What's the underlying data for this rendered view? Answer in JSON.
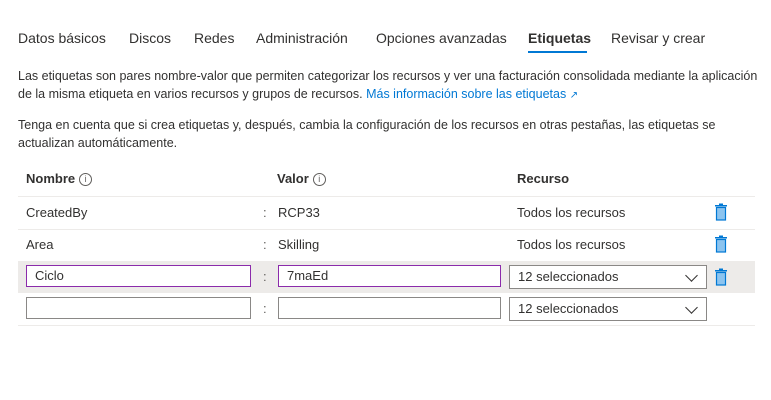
{
  "tabs": [
    {
      "label": "Datos básicos"
    },
    {
      "label": "Discos"
    },
    {
      "label": "Redes"
    },
    {
      "label": "Administración"
    },
    {
      "label": "Opciones avanzadas"
    },
    {
      "label": "Etiquetas",
      "active": true
    },
    {
      "label": "Revisar y crear"
    }
  ],
  "intro": {
    "text": "Las etiquetas son pares nombre-valor que permiten categorizar los recursos y ver una facturación consolidada mediante la aplicación de la misma etiqueta en varios recursos y grupos de recursos.",
    "link": "Más información sobre las etiquetas"
  },
  "note": "Tenga en cuenta que si crea etiquetas y, después, cambia la configuración de los recursos en otras pestañas, las etiquetas se actualizan automáticamente.",
  "table": {
    "headers": {
      "name": "Nombre",
      "value": "Valor",
      "resource": "Recurso"
    },
    "colon": ":",
    "rows": [
      {
        "name": "CreatedBy",
        "value": "RCP33",
        "resource": "Todos los recursos"
      },
      {
        "name": "Area",
        "value": "Skilling",
        "resource": "Todos los recursos"
      }
    ],
    "edit_row": {
      "name": "Ciclo",
      "value": "7maEd",
      "resource": "12 seleccionados"
    },
    "new_row": {
      "name": "",
      "value": "",
      "resource": "12 seleccionados"
    }
  },
  "colors": {
    "accent": "#0078d4",
    "focus_border": "#8b2bab",
    "row_highlight": "#edebe9"
  }
}
